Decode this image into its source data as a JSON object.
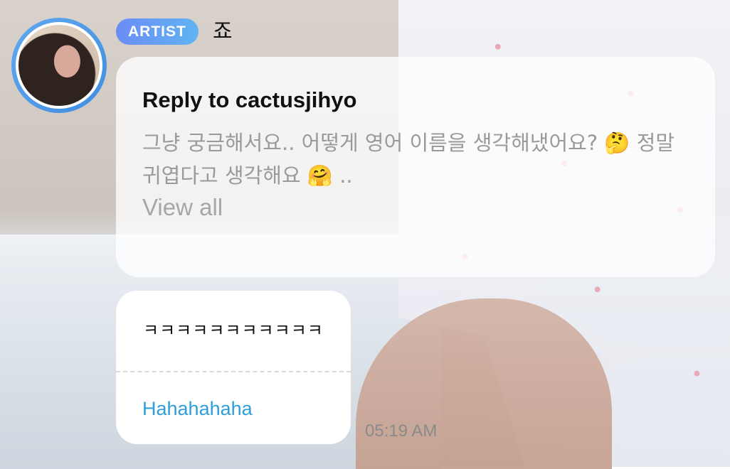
{
  "header": {
    "badge_label": "ARTIST",
    "artist_name": "죠"
  },
  "reply": {
    "title": "Reply to cactusjihyo",
    "quote_text": "그냥 궁금해서요.. 어떻게 영어 이름을 생각해냈어요? 🤔 정말 귀엽다고 생각해요 🤗 ..",
    "view_all_label": "View all"
  },
  "message": {
    "original_text": "ㅋㅋㅋㅋㅋㅋㅋㅋㅋㅋㅋ",
    "translation_text": "Hahahahaha",
    "timestamp": "05:19 AM"
  },
  "colors": {
    "badge_gradient_start": "#6c8cf5",
    "badge_gradient_end": "#5fb4f4",
    "avatar_ring": "#4f9be8",
    "translation_text": "#2f9fd8"
  }
}
